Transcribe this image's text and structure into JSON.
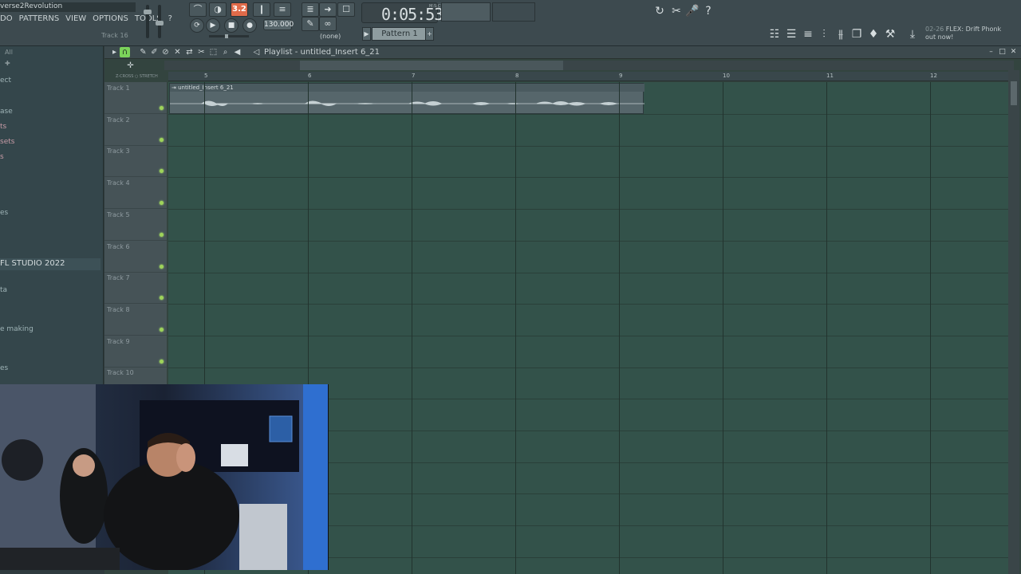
{
  "topbar": {
    "song_title": "verse2Revolution",
    "menu": [
      "DO",
      "PATTERNS",
      "VIEW",
      "OPTIONS",
      "TOOLS",
      "?"
    ],
    "hint_text": "Track 16",
    "pattern_mode_value": "3.2",
    "tempo": "130.000",
    "time": "0:05:53",
    "time_unit": "M:S:CS",
    "none_label": "(none)",
    "pattern_name": "Pattern 1",
    "news_date": "02-26",
    "news_text": "FLEX: Drift Phonk out now!"
  },
  "browser": {
    "header_all": "All",
    "items": [
      {
        "label": "ect",
        "style": "normal"
      },
      {
        "label": "ase",
        "style": "normal"
      },
      {
        "label": "ts",
        "style": "pink"
      },
      {
        "label": "sets",
        "style": "pink"
      },
      {
        "label": "s",
        "style": "pink"
      },
      {
        "label": "es",
        "style": "normal"
      },
      {
        "label": "FL STUDIO 2022",
        "style": "header"
      },
      {
        "label": "ta",
        "style": "normal"
      },
      {
        "label": "e making",
        "style": "normal"
      },
      {
        "label": "es",
        "style": "normal"
      }
    ]
  },
  "playlist": {
    "title": "Playlist - untitled_Insert 6_21",
    "zoom_label": "Z-CROSS ○ STRETCH",
    "bar_numbers": [
      "5",
      "6",
      "7",
      "8",
      "9",
      "10",
      "11",
      "12"
    ],
    "tracks": [
      "Track 1",
      "Track 2",
      "Track 3",
      "Track 4",
      "Track 5",
      "Track 6",
      "Track 7",
      "Track 8",
      "Track 9",
      "Track 10"
    ],
    "clip_label": "untitled_Insert 6_21"
  },
  "colors": {
    "accent_green": "#7bd35a",
    "record_orange": "#e06b4a",
    "grid_bg": "#33524a"
  }
}
